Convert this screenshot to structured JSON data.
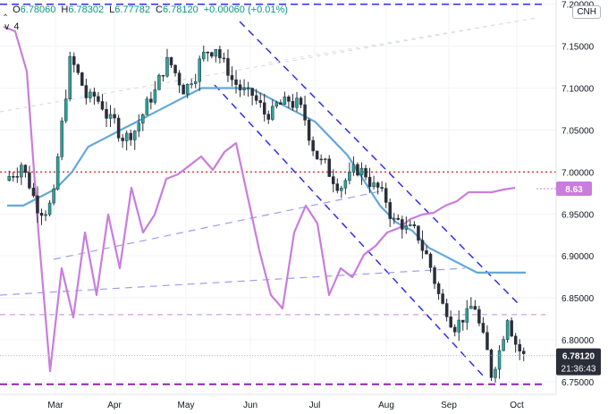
{
  "header": {
    "open_label": "O",
    "open": "6.78060",
    "high_label": "H",
    "high": "6.78302",
    "low_label": "L",
    "low": "6.77782",
    "close_label": "C",
    "close": "6.78120",
    "change": "+0.00060 (+0.01%)",
    "indicator_count": "4",
    "currency": "CNH"
  },
  "price_axis": {
    "ticks": [
      "7.20000",
      "7.15000",
      "7.10000",
      "7.05000",
      "7.00000",
      "6.95000",
      "6.90000",
      "6.85000",
      "6.80000",
      "6.75000"
    ]
  },
  "time_axis": {
    "months": [
      "Mar",
      "Apr",
      "May",
      "Jun",
      "Jul",
      "Aug",
      "Sep",
      "Oct"
    ]
  },
  "labels": {
    "indicator_value": "8.63",
    "last_price": "6.78120",
    "countdown": "21:36:43"
  },
  "colors": {
    "up": "#26a69a",
    "down": "#ef5350",
    "candle": "#2a2e39",
    "ma": "#64a8d8",
    "osc": "#c97ddc",
    "trend": "#2d2df0",
    "resistance": "#e53935",
    "support": "#8e24aa"
  },
  "chart_data": {
    "type": "candlestick",
    "symbol": "CNH",
    "x": [
      "2020-02-17",
      "2020-02-24",
      "2020-03-02",
      "2020-03-09",
      "2020-03-16",
      "2020-03-23",
      "2020-03-30",
      "2020-04-06",
      "2020-04-13",
      "2020-04-20",
      "2020-04-27",
      "2020-05-04",
      "2020-05-11",
      "2020-05-18",
      "2020-05-25",
      "2020-06-01",
      "2020-06-08",
      "2020-06-15",
      "2020-06-22",
      "2020-06-29",
      "2020-07-06",
      "2020-07-13",
      "2020-07-20",
      "2020-07-27",
      "2020-08-03",
      "2020-08-10",
      "2020-08-17",
      "2020-08-24",
      "2020-08-31",
      "2020-09-07",
      "2020-09-14",
      "2020-09-21",
      "2020-09-28"
    ],
    "close": [
      6.99,
      7.01,
      6.96,
      6.97,
      7.13,
      7.09,
      7.08,
      7.05,
      7.05,
      7.09,
      7.13,
      7.1,
      7.13,
      7.15,
      7.11,
      7.09,
      7.07,
      7.08,
      7.08,
      7.03,
      7.0,
      6.99,
      7.0,
      6.98,
      6.94,
      6.93,
      6.9,
      6.84,
      6.82,
      6.84,
      6.76,
      6.83,
      6.78
    ],
    "moving_average": [
      6.96,
      6.96,
      6.97,
      6.98,
      7.0,
      7.03,
      7.04,
      7.05,
      7.06,
      7.07,
      7.08,
      7.09,
      7.1,
      7.1,
      7.1,
      7.1,
      7.09,
      7.08,
      7.07,
      7.06,
      7.04,
      7.02,
      6.99,
      6.96,
      6.94,
      6.93,
      6.91,
      6.9,
      6.89,
      6.88,
      6.88,
      6.88,
      6.88
    ],
    "last_price": 6.7812,
    "indicator_last": 8.63,
    "open": 6.7806,
    "high": 6.78302,
    "low": 6.77782,
    "horizontal_levels": [
      7.2,
      7.0,
      6.83,
      6.747
    ],
    "ylim": [
      6.735,
      7.205
    ],
    "ylabel": "",
    "xlabel": "",
    "title": ""
  }
}
